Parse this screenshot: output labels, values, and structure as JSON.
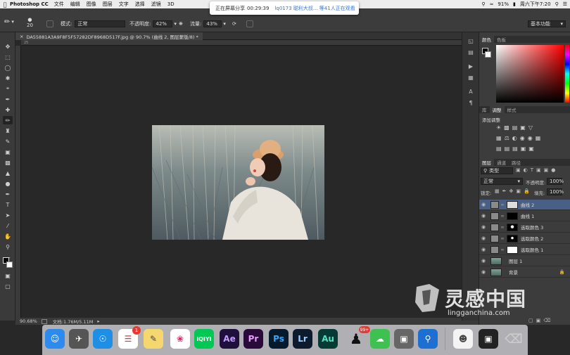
{
  "menubar": {
    "app_name": "Photoshop CC",
    "items": [
      "文件",
      "编辑",
      "图像",
      "图层",
      "文字",
      "选择",
      "滤镜",
      "3D"
    ],
    "battery": "91%",
    "datetime": "周六下午7:20"
  },
  "share_banner": {
    "status": "正在屏幕分享",
    "timer": "00:29:39",
    "viewers": "lq0173 聪利大叔... 等41人正在观看"
  },
  "options_bar": {
    "brush_size": "20",
    "mode_label": "模式:",
    "mode_value": "正常",
    "opacity_label": "不透明度:",
    "opacity_value": "42%",
    "flow_label": "流量:",
    "flow_value": "43%",
    "workspace": "基本功能"
  },
  "document": {
    "tab_title": "DA55881A3A9F8F5F57282DF8968D517F.jpg @ 90.7% (曲线 2, 图层蒙版/8) *",
    "ruler_label": "25",
    "zoom": "90.68%",
    "doc_size": "文档:1.76M/5.11M"
  },
  "color_panel": {
    "tabs": [
      "颜色",
      "色板"
    ]
  },
  "adjust_panel": {
    "tabs": [
      "库",
      "调整",
      "样式"
    ],
    "heading": "添加调整"
  },
  "layers_panel": {
    "tabs": [
      "图层",
      "通道",
      "路径"
    ],
    "filter_type": "类型",
    "blend_mode": "正常",
    "opacity_label": "不透明度:",
    "opacity_value": "100%",
    "lock_label": "锁定:",
    "fill_label": "填充:",
    "fill_value": "100%",
    "layers": [
      {
        "name": "曲线 2",
        "selected": true,
        "kind": "adjust"
      },
      {
        "name": "曲线 1",
        "selected": false,
        "kind": "adjust"
      },
      {
        "name": "选取颜色 3",
        "selected": false,
        "kind": "adjust-black"
      },
      {
        "name": "选取颜色 2",
        "selected": false,
        "kind": "adjust-black"
      },
      {
        "name": "选取颜色 1",
        "selected": false,
        "kind": "adjust"
      },
      {
        "name": "图层 1",
        "selected": false,
        "kind": "image"
      },
      {
        "name": "背景",
        "selected": false,
        "kind": "image"
      }
    ]
  },
  "dock": {
    "badge_reminders": "1",
    "badge_qq": "99+",
    "apps": [
      "Ae",
      "Pr",
      "Ps",
      "Lr",
      "Au"
    ],
    "iqiyi": "iQIYI"
  },
  "watermark": {
    "brand": "灵感中国",
    "url": "lingganchina.com"
  }
}
